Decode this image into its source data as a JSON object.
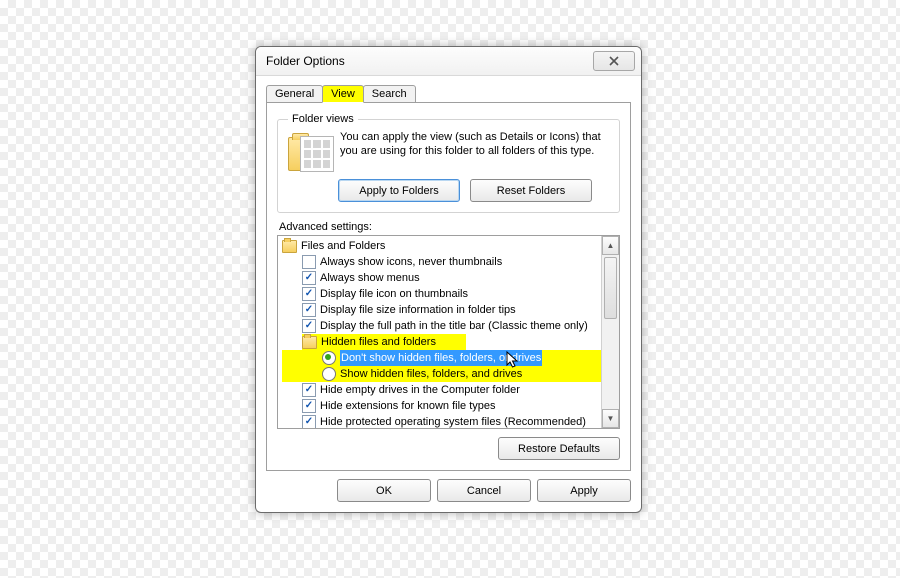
{
  "title": "Folder Options",
  "tabs": {
    "general": "General",
    "view": "View",
    "search": "Search"
  },
  "folderViews": {
    "legend": "Folder views",
    "desc": "You can apply the view (such as Details or Icons) that you are using for this folder to all folders of this type.",
    "apply": "Apply to Folders",
    "reset": "Reset Folders"
  },
  "advanced": {
    "label": "Advanced settings:",
    "root": "Files and Folders",
    "items": [
      {
        "type": "check",
        "checked": false,
        "label": "Always show icons, never thumbnails"
      },
      {
        "type": "check",
        "checked": true,
        "label": "Always show menus"
      },
      {
        "type": "check",
        "checked": true,
        "label": "Display file icon on thumbnails"
      },
      {
        "type": "check",
        "checked": true,
        "label": "Display file size information in folder tips"
      },
      {
        "type": "check",
        "checked": true,
        "label": "Display the full path in the title bar (Classic theme only)"
      }
    ],
    "hiddenGroup": {
      "label": "Hidden files and folders",
      "optDont": "Don't show hidden files, folders, or drives",
      "optShow": "Show hidden files, folders, and drives"
    },
    "items2": [
      {
        "type": "check",
        "checked": true,
        "label": "Hide empty drives in the Computer folder"
      },
      {
        "type": "check",
        "checked": true,
        "label": "Hide extensions for known file types"
      },
      {
        "type": "check",
        "checked": true,
        "label": "Hide protected operating system files (Recommended)"
      }
    ],
    "restore": "Restore Defaults"
  },
  "buttons": {
    "ok": "OK",
    "cancel": "Cancel",
    "apply": "Apply"
  }
}
